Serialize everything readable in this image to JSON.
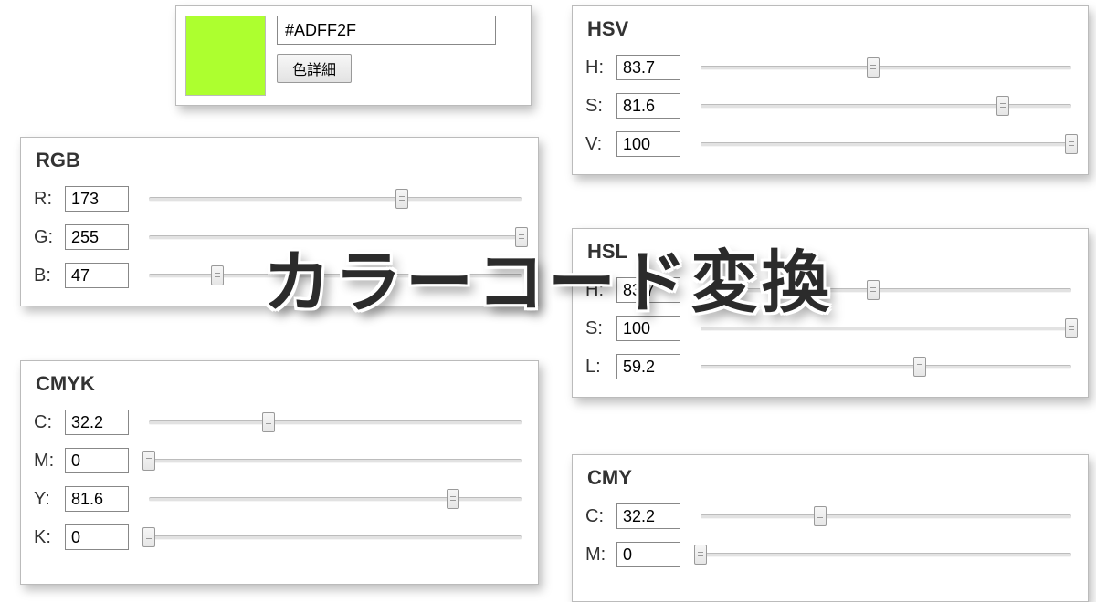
{
  "overlay_title": "カラーコード変換",
  "hex": {
    "value": "#ADFF2F",
    "button_label": "色詳細",
    "swatch_color": "#ADFF2F"
  },
  "rgb": {
    "title": "RGB",
    "rows": [
      {
        "label": "R:",
        "value": "173",
        "pos": 67.8
      },
      {
        "label": "G:",
        "value": "255",
        "pos": 100
      },
      {
        "label": "B:",
        "value": "47",
        "pos": 18.4
      }
    ]
  },
  "cmyk": {
    "title": "CMYK",
    "rows": [
      {
        "label": "C:",
        "value": "32.2",
        "pos": 32.2
      },
      {
        "label": "M:",
        "value": "0",
        "pos": 0
      },
      {
        "label": "Y:",
        "value": "81.6",
        "pos": 81.6
      },
      {
        "label": "K:",
        "value": "0",
        "pos": 0
      }
    ]
  },
  "hsv": {
    "title": "HSV",
    "rows": [
      {
        "label": "H:",
        "value": "83.7",
        "pos": 46.5
      },
      {
        "label": "S:",
        "value": "81.6",
        "pos": 81.6
      },
      {
        "label": "V:",
        "value": "100",
        "pos": 100
      }
    ]
  },
  "hsl": {
    "title": "HSL",
    "rows": [
      {
        "label": "H:",
        "value": "83.7",
        "pos": 46.5
      },
      {
        "label": "S:",
        "value": "100",
        "pos": 100
      },
      {
        "label": "L:",
        "value": "59.2",
        "pos": 59.2
      }
    ]
  },
  "cmy": {
    "title": "CMY",
    "rows": [
      {
        "label": "C:",
        "value": "32.2",
        "pos": 32.2
      },
      {
        "label": "M:",
        "value": "0",
        "pos": 0
      }
    ]
  }
}
